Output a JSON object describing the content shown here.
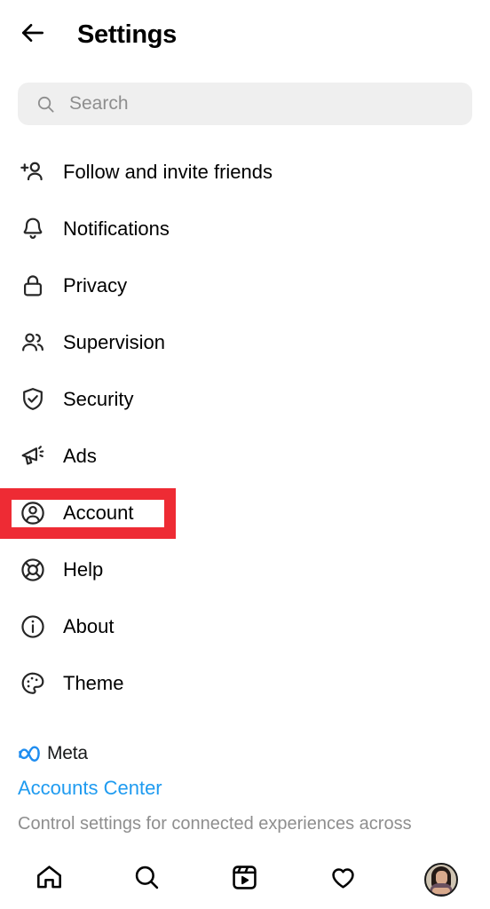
{
  "header": {
    "back_icon": "back-arrow-icon",
    "title": "Settings"
  },
  "search": {
    "icon": "search-icon",
    "placeholder": "Search",
    "value": ""
  },
  "menu": {
    "items": [
      {
        "label": "Follow and invite friends",
        "icon": "person-add-icon",
        "highlighted": false
      },
      {
        "label": "Notifications",
        "icon": "bell-icon",
        "highlighted": false
      },
      {
        "label": "Privacy",
        "icon": "lock-icon",
        "highlighted": false
      },
      {
        "label": "Supervision",
        "icon": "people-icon",
        "highlighted": false
      },
      {
        "label": "Security",
        "icon": "shield-check-icon",
        "highlighted": false
      },
      {
        "label": "Ads",
        "icon": "megaphone-icon",
        "highlighted": false
      },
      {
        "label": "Account",
        "icon": "account-circle-icon",
        "highlighted": true
      },
      {
        "label": "Help",
        "icon": "lifebuoy-icon",
        "highlighted": false
      },
      {
        "label": "About",
        "icon": "info-circle-icon",
        "highlighted": false
      },
      {
        "label": "Theme",
        "icon": "palette-icon",
        "highlighted": false
      }
    ]
  },
  "meta_section": {
    "logo_icon": "meta-infinity-icon",
    "brand": "Meta",
    "link_label": "Accounts Center",
    "description": "Control settings for connected experiences across"
  },
  "bottom_nav": {
    "items": [
      {
        "name": "home",
        "icon": "home-icon"
      },
      {
        "name": "search",
        "icon": "search-icon"
      },
      {
        "name": "reels",
        "icon": "reels-icon"
      },
      {
        "name": "activity",
        "icon": "heart-icon"
      },
      {
        "name": "profile",
        "icon": "avatar-icon"
      }
    ]
  },
  "colors": {
    "highlight_red": "#ee2b34",
    "link_blue": "#1f9bf0",
    "meta_blue": "#1f8df0",
    "search_bg": "#efefef",
    "muted_text": "#8e8e8e"
  }
}
